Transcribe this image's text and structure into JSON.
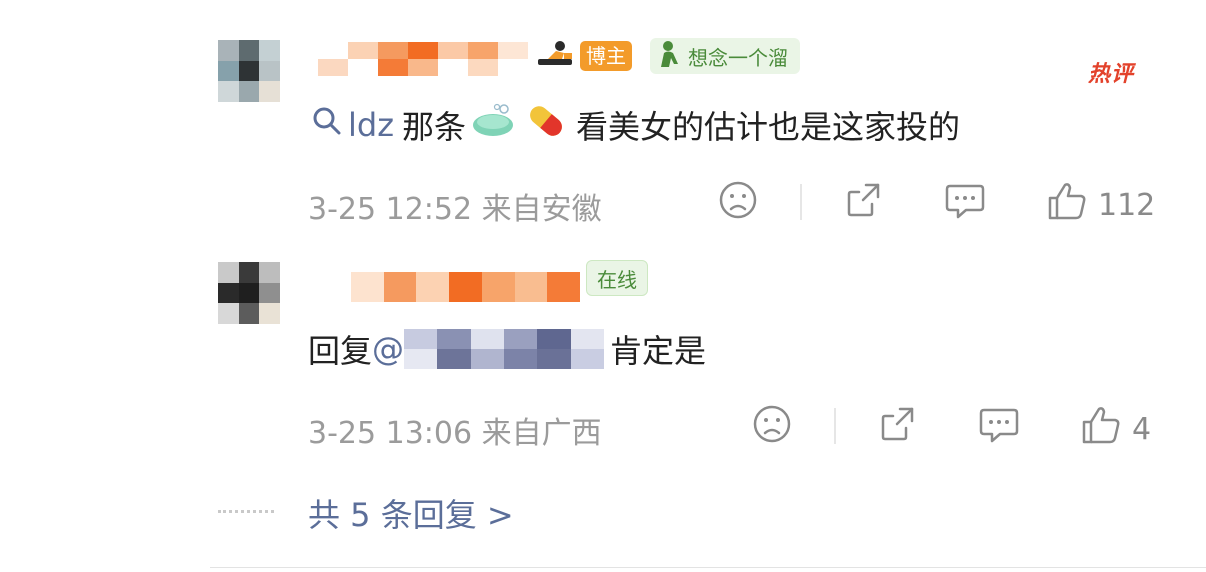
{
  "comment1": {
    "badge_blogger": "博主",
    "group_badge": "想念一个溜",
    "hot_tag": "热评",
    "content_link": "ldz",
    "content_mid": "那条",
    "content_tail": "看美女的估计也是这家投的",
    "meta": "3-25 12:52 来自安徽",
    "like_count": "112"
  },
  "comment2": {
    "online_badge": "在线",
    "reply_prefix": "回复 ",
    "mention_prefix": "@",
    "content_tail": "肯定是",
    "meta": "3-25 13:06 来自广西",
    "like_count": "4"
  },
  "footer": {
    "more_replies": "共 5 条回复 >"
  },
  "colors": {
    "link": "#5b6e99",
    "meta": "#9b9b9b",
    "hot": "#e3422b",
    "blogger": "#f39b2a",
    "group_green": "#4a8b3a"
  }
}
